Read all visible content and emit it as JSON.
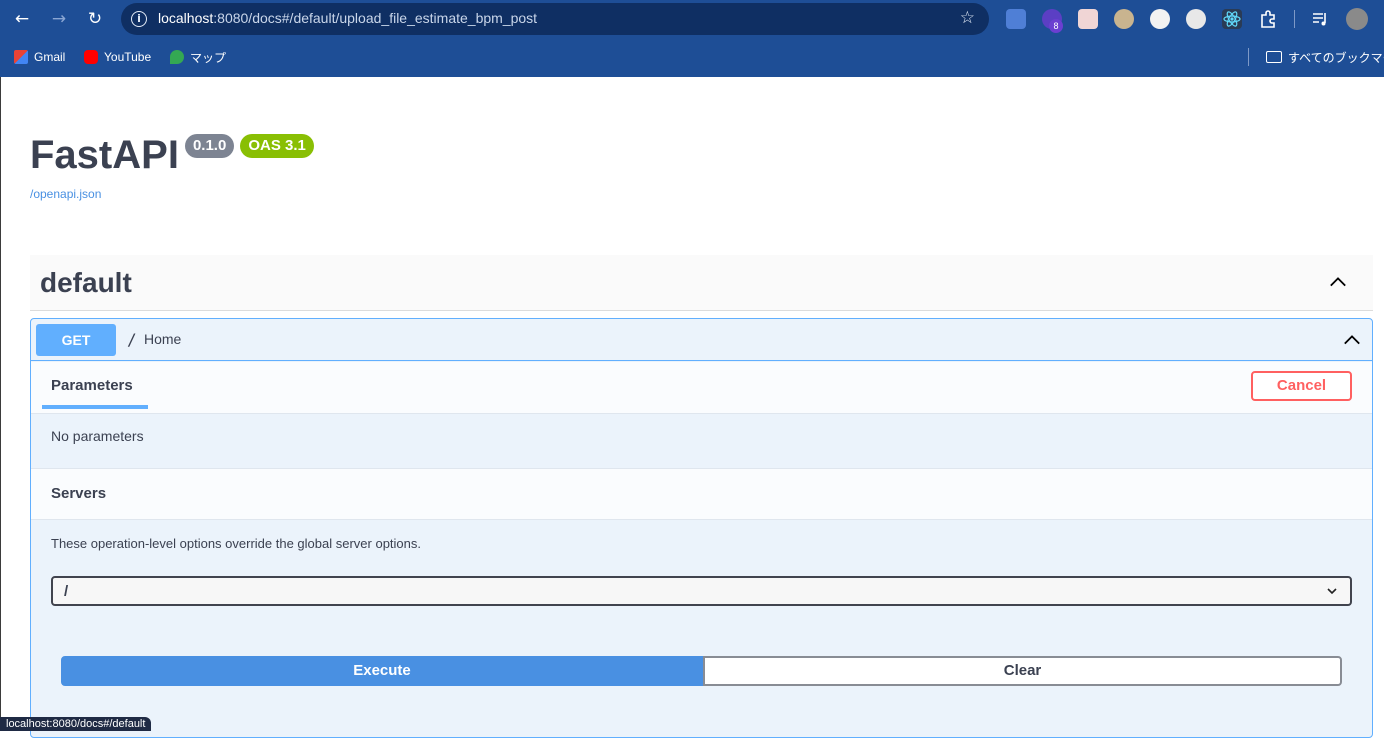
{
  "browser": {
    "url_host": "localhost",
    "url_rest": ":8080/docs#/default/upload_file_estimate_bpm_post",
    "extension_badge": "8",
    "bookmarks": [
      {
        "label": "Gmail",
        "icon": "gmail-icon"
      },
      {
        "label": "YouTube",
        "icon": "youtube-icon"
      },
      {
        "label": "マップ",
        "icon": "maps-icon"
      }
    ],
    "all_bookmarks_label": "すべてのブックマーク",
    "status_url": "localhost:8080/docs#/default"
  },
  "header": {
    "title": "FastAPI",
    "version_badge": "0.1.0",
    "oas_badge": "OAS 3.1",
    "spec_link": "/openapi.json"
  },
  "section": {
    "tag": "default"
  },
  "operation": {
    "method": "GET",
    "path": "/",
    "summary": "Home",
    "parameters_tab": "Parameters",
    "cancel_label": "Cancel",
    "no_parameters": "No parameters",
    "servers_title": "Servers",
    "servers_description": "These operation-level options override the global server options.",
    "server_selected": "/",
    "execute_label": "Execute",
    "clear_label": "Clear"
  },
  "colors": {
    "get": "#61affe",
    "cancel": "#ff6060",
    "execute": "#4990e2",
    "oas": "#89bf04",
    "version": "#7d8492",
    "chrome": "#1e4e96"
  }
}
